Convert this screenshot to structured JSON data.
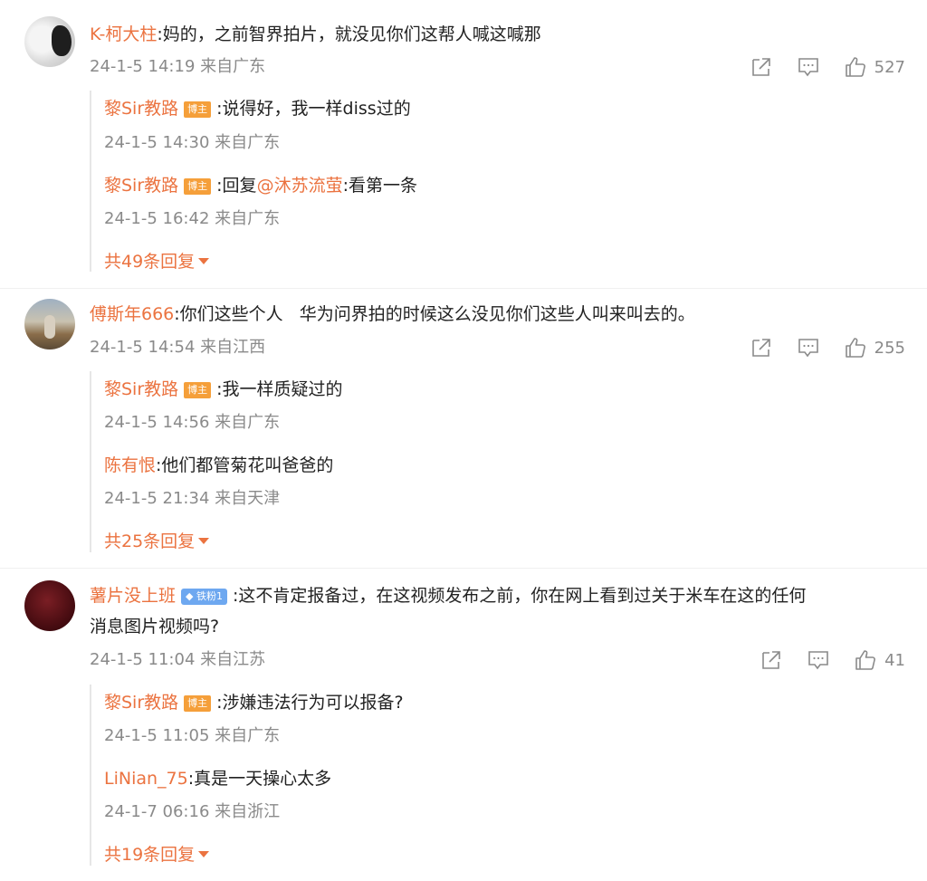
{
  "comments": [
    {
      "user": "K-柯大柱",
      "text": ":妈的，之前智界拍片，就没见你们这帮人喊这喊那",
      "meta": "24-1-5 14:19 来自广东",
      "likes": "527",
      "replies": [
        {
          "user": "黎Sir教路",
          "badge": "博主",
          "text": ":说得好，我一样diss过的",
          "meta": "24-1-5 14:30 来自广东"
        },
        {
          "user": "黎Sir教路",
          "badge": "博主",
          "text_prefix": ":回复",
          "mention": "@沐苏流萤",
          "text": ":看第一条",
          "meta": "24-1-5 16:42 来自广东"
        }
      ],
      "more": "共49条回复"
    },
    {
      "user": "傅斯年666",
      "text": ":你们这些个人   华为问界拍的时候这么没见你们这些人叫来叫去的。",
      "meta": "24-1-5 14:54 来自江西",
      "likes": "255",
      "replies": [
        {
          "user": "黎Sir教路",
          "badge": "博主",
          "text": ":我一样质疑过的",
          "meta": "24-1-5 14:56 来自广东"
        },
        {
          "user": "陈有恨",
          "text": ":他们都管菊花叫爸爸的",
          "meta": "24-1-5 21:34 来自天津"
        }
      ],
      "more": "共25条回复"
    },
    {
      "user": "薯片没上班",
      "fan_badge": "铁粉1",
      "text": ":这不肯定报备过，在这视频发布之前，你在网上看到过关于米车在这的任何",
      "text2": "消息图片视频吗?",
      "meta": "24-1-5 11:04 来自江苏",
      "likes": "41",
      "replies": [
        {
          "user": "黎Sir教路",
          "badge": "博主",
          "text": ":涉嫌违法行为可以报备?",
          "meta": "24-1-5 11:05 来自广东"
        },
        {
          "user": "LiNian_75",
          "text": ":真是一天操心太多",
          "meta": "24-1-7 06:16 来自浙江"
        }
      ],
      "more": "共19条回复"
    }
  ],
  "icons": {
    "share": "share-icon",
    "comment": "comment-icon",
    "like": "thumbs-up-icon"
  },
  "colors": {
    "accent": "#eb7340",
    "badge": "#f59f3a",
    "fan_badge": "#6ea8f0",
    "meta": "#8a8a8a"
  }
}
